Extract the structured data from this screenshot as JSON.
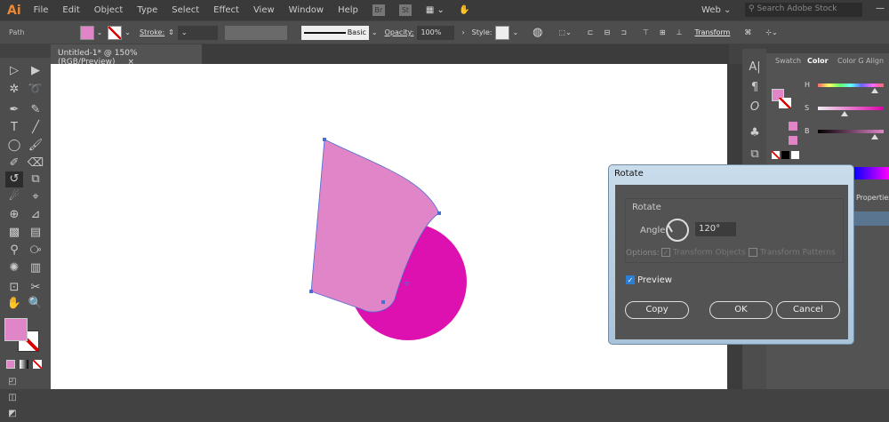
{
  "app": {
    "logo": "Ai"
  },
  "menu": [
    "File",
    "Edit",
    "Object",
    "Type",
    "Select",
    "Effect",
    "View",
    "Window",
    "Help"
  ],
  "menu_icons": {
    "bridge": "Br",
    "stock": "St"
  },
  "workspace": "Web",
  "search": {
    "placeholder": "Search Adobe Stock"
  },
  "control": {
    "selection": "Path",
    "fill_color": "#df85c8",
    "stroke_label": "Stroke:",
    "brush": "Basic",
    "opacity_label": "Opacity:",
    "opacity": "100%",
    "style_label": "Style:",
    "transform": "Transform"
  },
  "doc_tab": {
    "title": "Untitled-1* @ 150% (RGB/Preview)",
    "close": "×"
  },
  "panel": {
    "tabs": [
      "Swatch",
      "Color",
      "Color G",
      "Align"
    ],
    "active": "Color",
    "sliders": [
      {
        "label": "H",
        "value": 0.86
      },
      {
        "label": "S",
        "value": 0.4
      },
      {
        "label": "B",
        "value": 0.87
      }
    ],
    "properties": "Properties"
  },
  "artwork": {
    "shape_fill": "#df85c8",
    "circle_fill": "#dd10b0",
    "stroke": "#4a6cd4"
  },
  "dialog": {
    "title": "Rotate",
    "group": "Rotate",
    "angle_label": "Angle:",
    "angle": "120°",
    "options_label": "Options:",
    "transform_objects": "Transform Objects",
    "transform_objects_checked": true,
    "transform_patterns": "Transform Patterns",
    "transform_patterns_checked": false,
    "preview": "Preview",
    "preview_checked": true,
    "copy": "Copy",
    "ok": "OK",
    "cancel": "Cancel"
  }
}
